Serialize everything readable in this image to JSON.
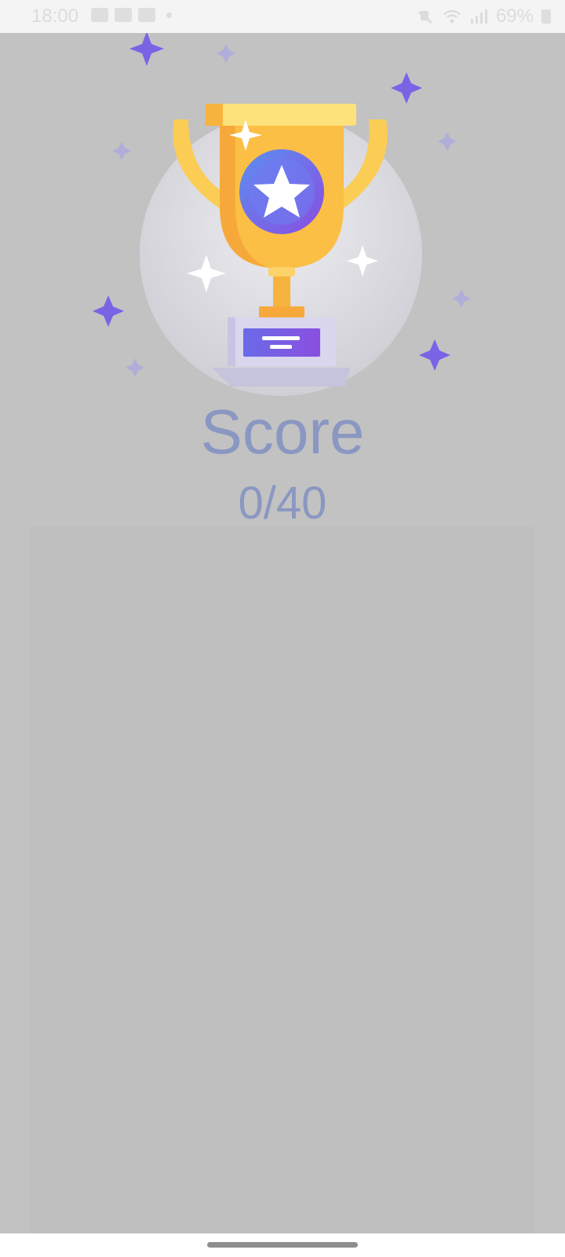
{
  "status_bar": {
    "time": "18:00",
    "left_icons": [
      "gallery-icon",
      "youtube-icon",
      "youtube-icon",
      "dot-icon"
    ],
    "right_icons": [
      "mute-icon",
      "wifi-icon",
      "signal-icon"
    ],
    "battery": "69%"
  },
  "result": {
    "title": "Score",
    "score": "0/40",
    "illustration": "trophy-icon"
  },
  "colors": {
    "score_text": "#8a97c2",
    "trophy_gold": "#fbbf45",
    "sparkle": "#7b63e5"
  }
}
